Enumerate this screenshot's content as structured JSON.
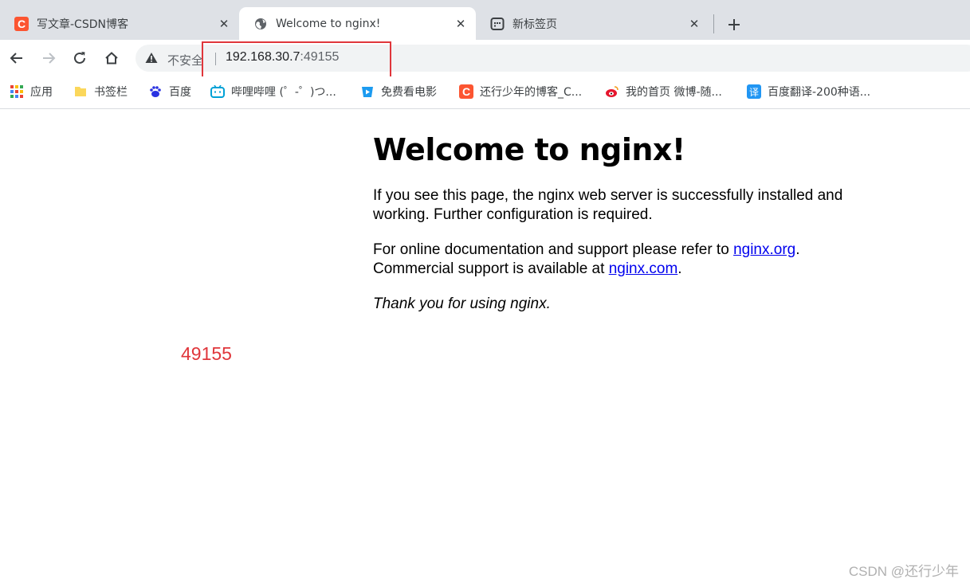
{
  "tabs": [
    {
      "title": "写文章-CSDN博客",
      "favicon": "csdn-icon",
      "favicon_text": "C"
    },
    {
      "title": "Welcome to nginx!",
      "favicon": "globe-icon",
      "active": true
    },
    {
      "title": "新标签页",
      "favicon": "newtab-icon"
    }
  ],
  "toolbar": {
    "security_label": "不安全",
    "url_host": "192.168.30.7",
    "url_port": ":49155"
  },
  "bookmarks": [
    {
      "label": "应用",
      "icon": "apps-grid-icon"
    },
    {
      "label": "书签栏",
      "icon": "folder-icon"
    },
    {
      "label": "百度",
      "icon": "baidu-paw-icon"
    },
    {
      "label": "哔哩哔哩 (゜-゜)つ...",
      "icon": "bilibili-icon"
    },
    {
      "label": "免费看电影",
      "icon": "video-play-icon"
    },
    {
      "label": "还行少年的博客_C...",
      "icon": "csdn-icon",
      "icon_text": "C"
    },
    {
      "label": "我的首页 微博-随...",
      "icon": "weibo-icon"
    },
    {
      "label": "百度翻译-200种语...",
      "icon": "translate-icon",
      "icon_text": "译"
    }
  ],
  "page": {
    "heading": "Welcome to nginx!",
    "p1": "If you see this page, the nginx web server is successfully installed and working. Further configuration is required.",
    "p2_before": "For online documentation and support please refer to ",
    "link1": "nginx.org",
    "p2_mid": ".",
    "p2_line2": "Commercial support is available at ",
    "link2": "nginx.com",
    "p2_end": ".",
    "p3": "Thank you for using nginx."
  },
  "annotation": "49155",
  "watermark": "CSDN @还行少年",
  "colors": {
    "accent_red": "#e0363b",
    "csdn_orange": "#fc5531",
    "link": "#0000ee"
  }
}
